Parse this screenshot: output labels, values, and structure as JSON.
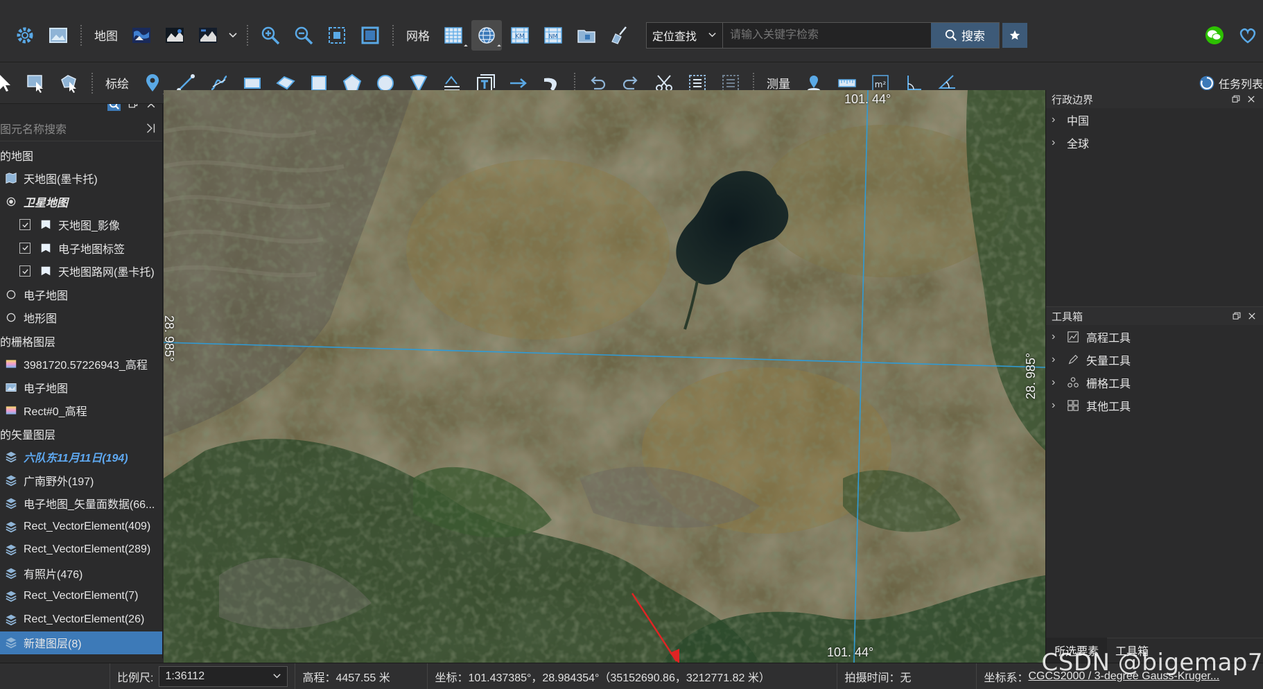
{
  "toolbar1": {
    "map_label": "地图",
    "grid_label": "网格",
    "locate_select": "定位查找",
    "search_placeholder": "请输入关键字检索",
    "search_button": "搜索"
  },
  "toolbar2": {
    "plot_label": "标绘",
    "measure_label": "测量",
    "task_list": "任务列表"
  },
  "left_panel": {
    "search_placeholder": "图元名称搜索",
    "rows": [
      {
        "label": "的地图",
        "indent": 0,
        "icon": "none"
      },
      {
        "label": "天地图(墨卡托)",
        "indent": 4,
        "icon": "map-icon"
      },
      {
        "label": "卫星地图",
        "indent": 4,
        "icon": "radio-icon",
        "style": "bold-italic"
      },
      {
        "label": "天地图_影像",
        "indent": 28,
        "icon": "layer-icon",
        "checkbox": true
      },
      {
        "label": "电子地图标签",
        "indent": 28,
        "icon": "layer-icon",
        "checkbox": true
      },
      {
        "label": "天地图路网(墨卡托)",
        "indent": 28,
        "icon": "layer-icon",
        "checkbox": true
      },
      {
        "label": "电子地图",
        "indent": 4,
        "icon": "radio-empty-icon"
      },
      {
        "label": "地形图",
        "indent": 4,
        "icon": "radio-empty-icon"
      },
      {
        "label": "的栅格图层",
        "indent": 0,
        "icon": "none"
      },
      {
        "label": "3981720.57226943_高程",
        "indent": 4,
        "icon": "raster-icon"
      },
      {
        "label": "电子地图",
        "indent": 4,
        "icon": "image-icon"
      },
      {
        "label": "Rect#0_高程",
        "indent": 4,
        "icon": "raster-icon"
      },
      {
        "label": "的矢量图层",
        "indent": 0,
        "icon": "none"
      },
      {
        "label": "六队东11月11日(194)",
        "indent": 4,
        "icon": "stack-icon",
        "style": "italic-blue"
      },
      {
        "label": "广南野外(197)",
        "indent": 4,
        "icon": "stack-icon"
      },
      {
        "label": "电子地图_矢量面数据(66...",
        "indent": 4,
        "icon": "stack-icon"
      },
      {
        "label": "Rect_VectorElement(409)",
        "indent": 4,
        "icon": "stack-icon"
      },
      {
        "label": "Rect_VectorElement(289)",
        "indent": 4,
        "icon": "stack-icon"
      },
      {
        "label": "有照片(476)",
        "indent": 4,
        "icon": "stack-icon"
      },
      {
        "label": "Rect_VectorElement(7)",
        "indent": 4,
        "icon": "stack-icon"
      },
      {
        "label": "Rect_VectorElement(26)",
        "indent": 4,
        "icon": "stack-icon"
      },
      {
        "label": "新建图层(8)",
        "indent": 4,
        "icon": "stack-icon",
        "style": "selected"
      }
    ]
  },
  "map": {
    "lon_top": "101. 44°",
    "lon_bottom": "101. 44°",
    "lat_left": "28. 985°",
    "lat_right": "28. 985°"
  },
  "right_panel": {
    "admin_title": "行政边界",
    "admin_items": [
      "中国",
      "全球"
    ],
    "toolbox_title": "工具箱",
    "tools": [
      {
        "label": "高程工具",
        "icon": "elevation-icon"
      },
      {
        "label": "矢量工具",
        "icon": "pen-icon"
      },
      {
        "label": "栅格工具",
        "icon": "raster-tool-icon"
      },
      {
        "label": "其他工具",
        "icon": "grid-tool-icon"
      }
    ],
    "tabs": [
      "所选要素",
      "工具箱"
    ]
  },
  "statusbar": {
    "scale_label": "比例尺:",
    "scale_value": "1:36112",
    "elevation": "高程：4457.55 米",
    "coords": "坐标：101.437385°，28.984354°（35152690.86，3212771.82 米）",
    "capture_time": "拍摄时间：无",
    "crs_label": "坐标系：",
    "crs_value": "CGCS2000 / 3-degree Gauss-Kruger..."
  },
  "watermark": "CSDN @bigemap7",
  "colors": {
    "accent": "#3d7ab8",
    "grid_line": "#2f9bd6",
    "search_button": "#3d5a78"
  }
}
